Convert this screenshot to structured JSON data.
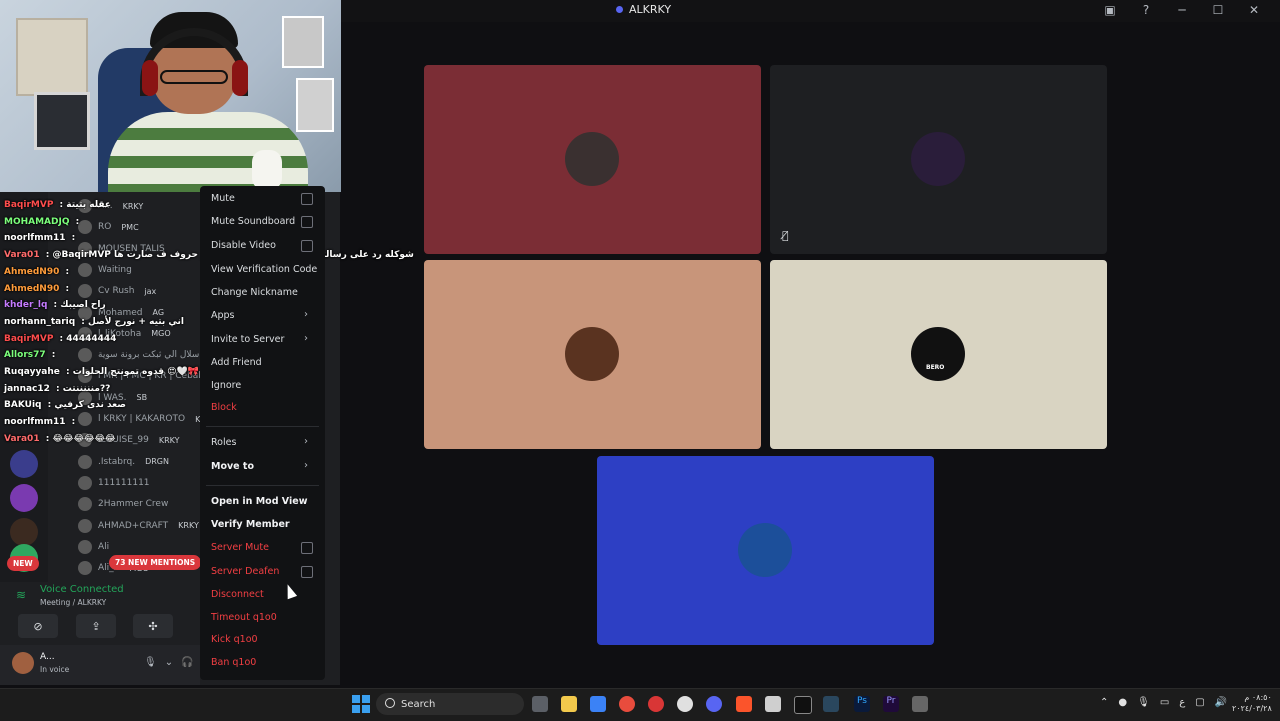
{
  "window": {
    "title": "ALKRKY",
    "controls": [
      "screen-share-icon",
      "help-icon",
      "minimize-icon",
      "maximize-icon",
      "close-icon"
    ]
  },
  "chat": [
    {
      "user": "BaqirMVP",
      "text": "عقله بتيتة",
      "color": "#ff4d4d"
    },
    {
      "user": "MOHAMADJQ",
      "text": "",
      "color": "#7cff7c"
    },
    {
      "user": "noorlfmm11",
      "text": "",
      "color": "#ffffff"
    },
    {
      "user": "Vara01",
      "text": "@BaqirMVP شوكله رد على رسالتي يقصد اي بس الكيك يطير حروف ف صارت ها",
      "color": "#ff6b6b"
    },
    {
      "user": "AhmedN90",
      "text": "",
      "color": "#ff9c3b"
    },
    {
      "user": "AhmedN90",
      "text": "",
      "color": "#ff9c3b"
    },
    {
      "user": "khder_lq",
      "text": "راح اصيبك",
      "color": "#c57bff"
    },
    {
      "user": "norhann_tariq",
      "text": "اني بتيه + نورج لأصل",
      "color": "#ffffff"
    },
    {
      "user": "BaqirMVP",
      "text": "44444444",
      "color": "#ff4d4d"
    },
    {
      "user": "Allors77",
      "text": "",
      "color": "#7cff7c"
    },
    {
      "user": "Ruqayyahe",
      "text": "قدوه تمونتج الحلوات 😍🤍🎀",
      "color": "#ffffff"
    },
    {
      "user": "jannac12",
      "text": "منننننتت??",
      "color": "#ffffff"
    },
    {
      "user": "BAKUiq",
      "text": "صعد ندى كرفيي",
      "color": "#ffffff"
    },
    {
      "user": "noorlfmm11",
      "text": "",
      "color": "#ffffff"
    },
    {
      "user": "Vara01",
      "text": "😂😂😂😂😂😂",
      "color": "#ff6b6b"
    }
  ],
  "members": [
    {
      "name": "A...",
      "tag": "KRKY"
    },
    {
      "name": "RO",
      "tag": "PMC"
    },
    {
      "name": "MOUSEN TALIS",
      "tag": ""
    },
    {
      "name": "Waiting",
      "tag": ""
    },
    {
      "name": "Cv Rush",
      "tag": "jax"
    },
    {
      "name": "Mohamed",
      "tag": "AG"
    },
    {
      "name": "l_liKotoha",
      "tag": "MGO"
    },
    {
      "name": "سلال الي ثبكت برونة سوية",
      "tag": ""
    },
    {
      "name": "l MR | PMC | KR | Ceballos",
      "tag": ""
    },
    {
      "name": "l WAS.",
      "tag": "SB"
    },
    {
      "name": "l KRKY | KAKAROTO",
      "tag": "KR"
    },
    {
      "name": "lLOUISE_99",
      "tag": "KRKY"
    },
    {
      "name": ".Istabrq.",
      "tag": "DRGN"
    },
    {
      "name": "111111111",
      "tag": ""
    },
    {
      "name": "2Hammer Crew",
      "tag": ""
    },
    {
      "name": "AHMAD+CRAFT",
      "tag": "KRKY"
    },
    {
      "name": "Ali",
      "tag": ""
    },
    {
      "name": "Ali_h",
      "tag": "MGO"
    }
  ],
  "badges": {
    "new": "NEW",
    "mentions": "73 NEW MENTIONS"
  },
  "voice": {
    "status": "Voice Connected",
    "channel": "Meeting / ALKRKY",
    "user_name": "A...",
    "user_status": "In voice"
  },
  "context_menu": {
    "mute": "Mute",
    "mute_soundboard": "Mute Soundboard",
    "disable_video": "Disable Video",
    "view_verification": "View Verification Code",
    "change_nickname": "Change Nickname",
    "apps": "Apps",
    "invite": "Invite to Server",
    "add_friend": "Add Friend",
    "ignore": "Ignore",
    "block": "Block",
    "roles": "Roles",
    "move_to": "Move to",
    "open_mod_view": "Open in Mod View",
    "verify_member": "Verify Member",
    "server_mute": "Server Mute",
    "server_deafen": "Server Deafen",
    "disconnect": "Disconnect",
    "timeout": "Timeout q1o0",
    "kick": "Kick q1o0",
    "ban": "Ban q1o0"
  },
  "tiles": [
    {
      "color": "#7b2d35",
      "avatar_color": "#3a3030"
    },
    {
      "color": "#1e1f22",
      "avatar_color": "#2a1d3a"
    },
    {
      "color": "#c8957a",
      "avatar_color": "#5a3320"
    },
    {
      "color": "#d9d4c2",
      "avatar_color": "#111111",
      "label": "BERO"
    },
    {
      "color": "#2d3fc4",
      "avatar_color": "#1c4f9a"
    }
  ],
  "taskbar": {
    "search_label": "Search",
    "clock_time": "٠٨:٥٠ م",
    "clock_date": "٢٠٢٤/٠٣/٢٨",
    "tray_lang": "ع"
  }
}
